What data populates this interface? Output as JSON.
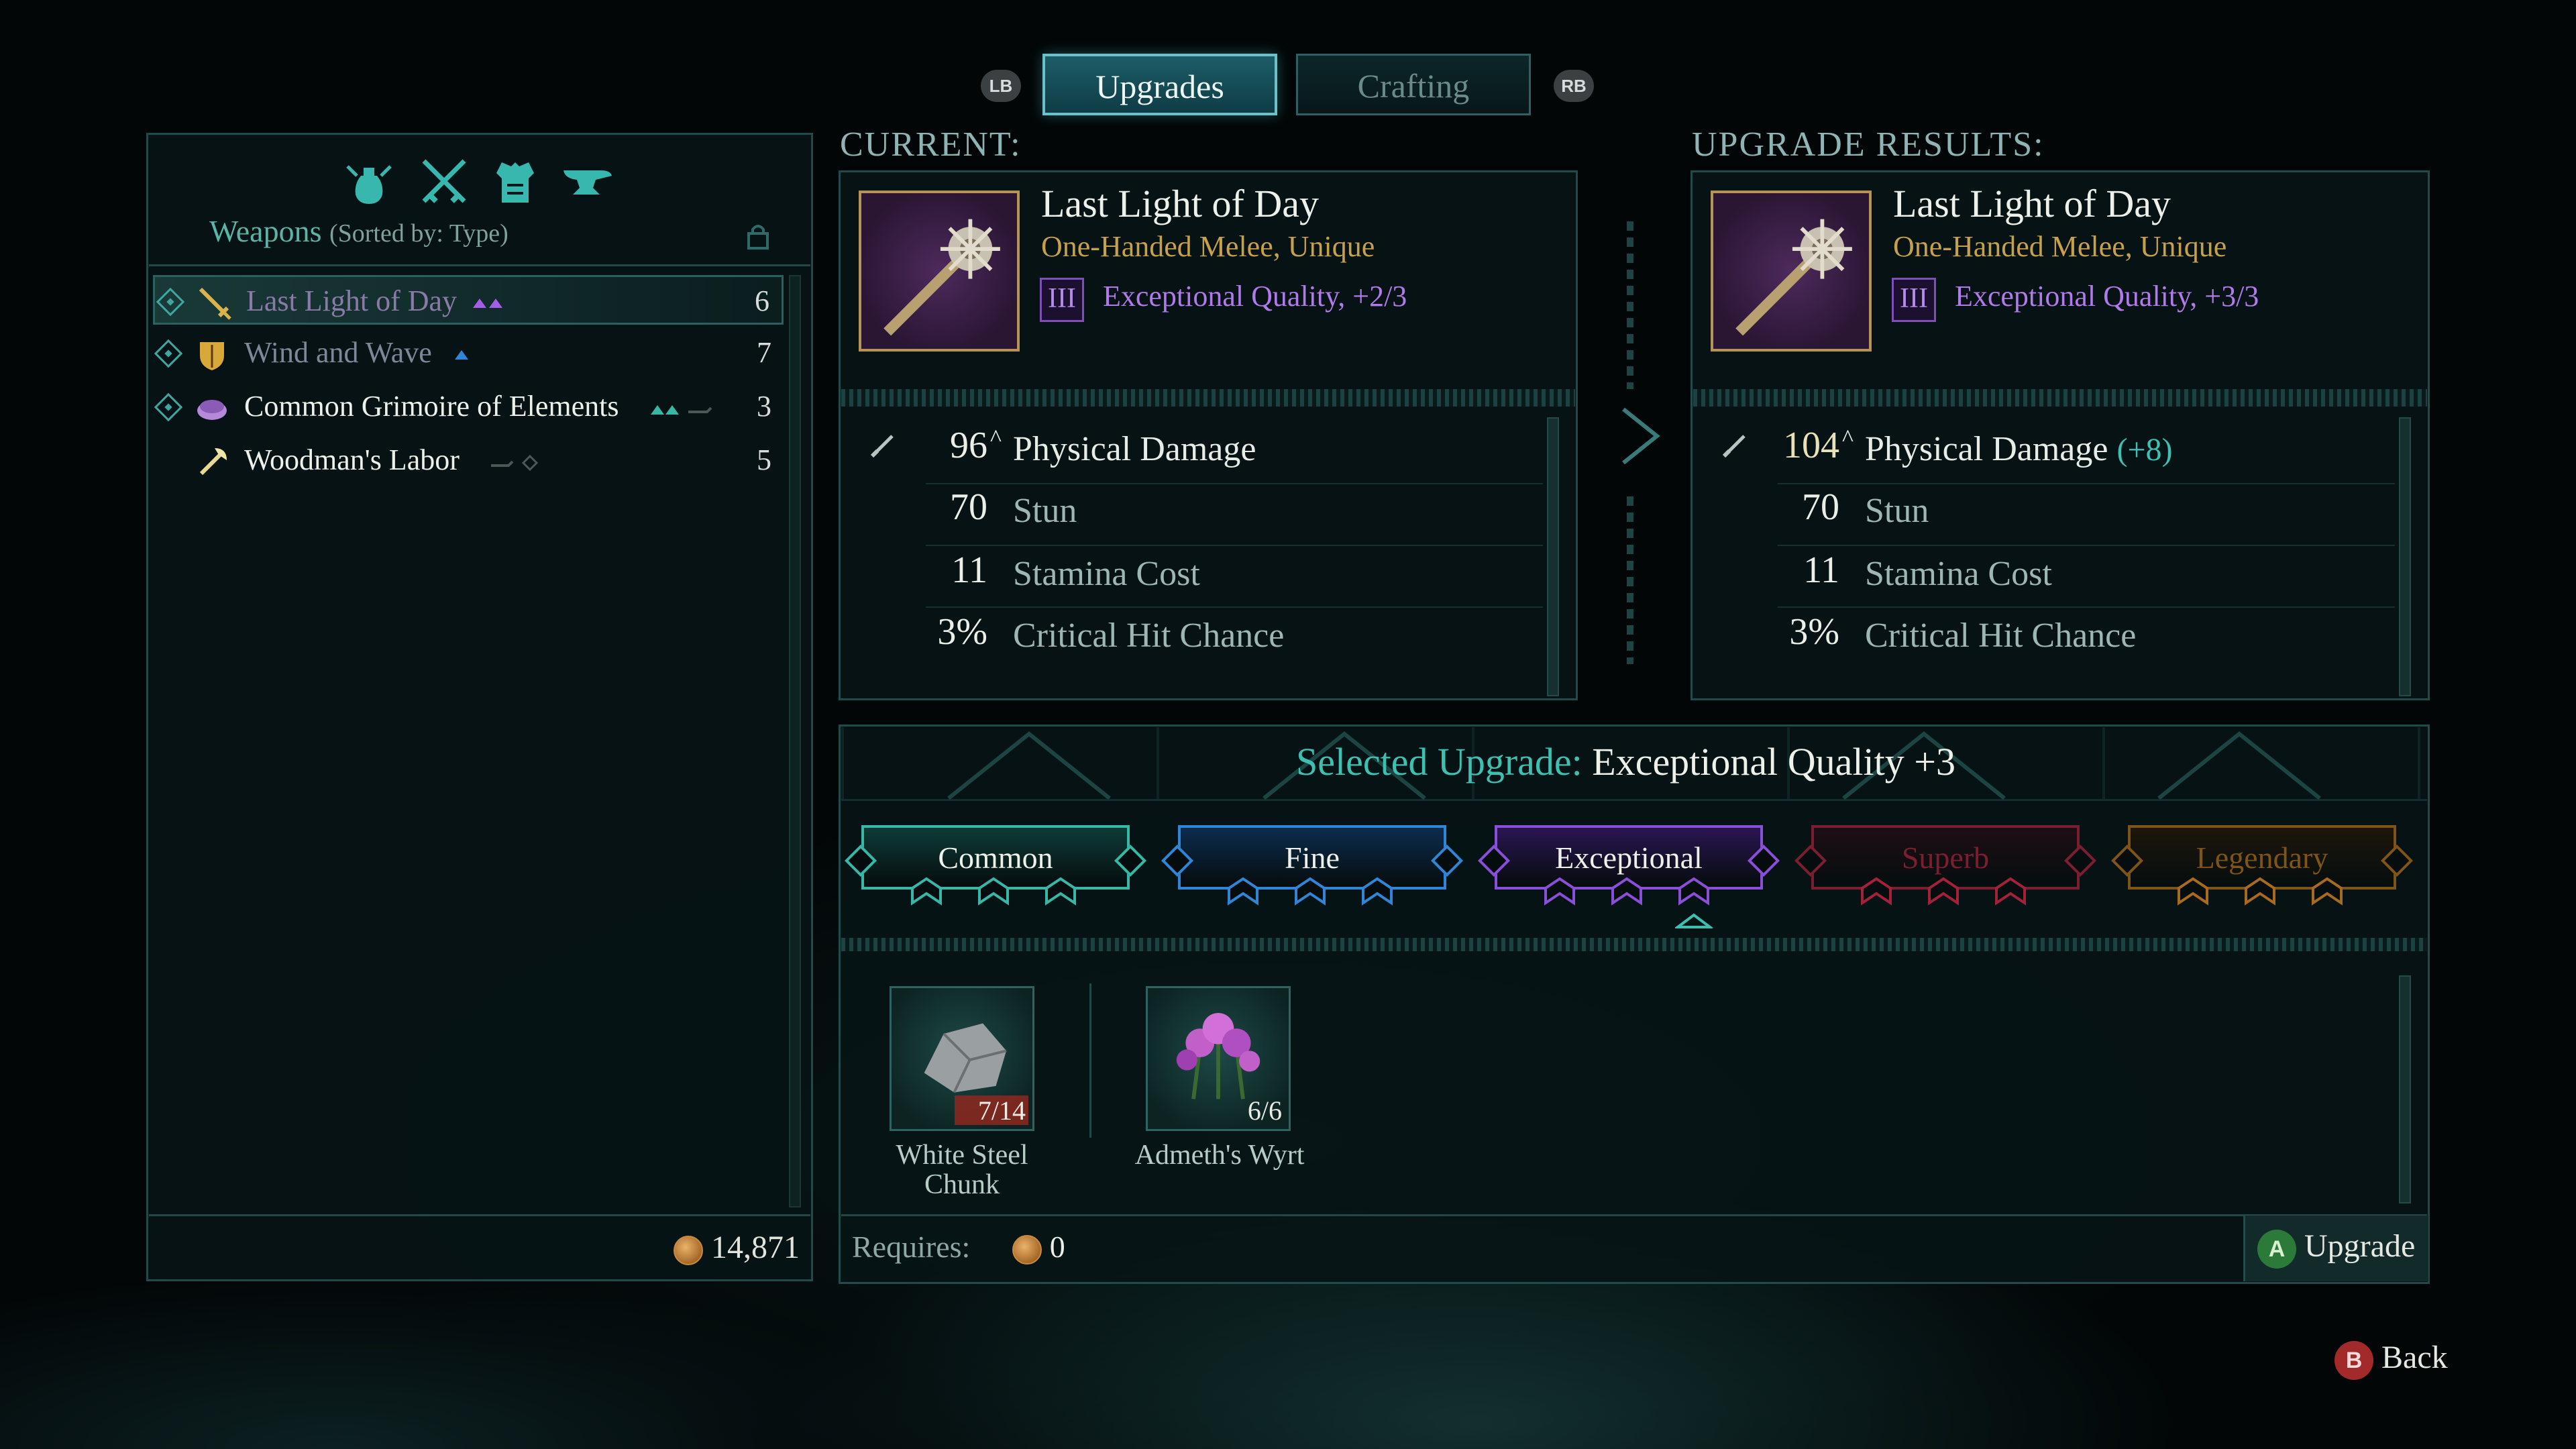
{
  "tabs": {
    "lb": "LB",
    "rb": "RB",
    "upgrades": "Upgrades",
    "crafting": "Crafting"
  },
  "weapons_panel": {
    "title": "Weapons",
    "sort": "(Sorted by: Type)",
    "category_icons": [
      "trinket-bag-icon",
      "crossed-swords-icon",
      "armor-icon",
      "anvil-icon"
    ],
    "items": [
      {
        "name": "Last Light of Day",
        "level": "6",
        "color": "#8a7aa8"
      },
      {
        "name": "Wind and Wave",
        "level": "7",
        "color": "#7d8799"
      },
      {
        "name": "Common Grimoire of Elements",
        "level": "3",
        "color": "#eef0ea"
      },
      {
        "name": "Woodman's Labor",
        "level": "5",
        "color": "#eef0ea"
      }
    ],
    "gold": "14,871"
  },
  "current": {
    "label": "CURRENT:",
    "name": "Last Light of Day",
    "type": "One-Handed Melee, Unique",
    "quality_badge": "III",
    "quality": "Exceptional Quality, +2/3",
    "stats": [
      {
        "value": "96",
        "label": "Physical Damage"
      },
      {
        "value": "70",
        "label": "Stun"
      },
      {
        "value": "11",
        "label": "Stamina Cost"
      },
      {
        "value": "3%",
        "label": "Critical Hit Chance"
      }
    ]
  },
  "result": {
    "label": "UPGRADE RESULTS:",
    "name": "Last Light of Day",
    "type": "One-Handed Melee, Unique",
    "quality_badge": "III",
    "quality": "Exceptional Quality, +3/3",
    "stats": [
      {
        "value": "104",
        "label": "Physical Damage",
        "delta": "(+8)"
      },
      {
        "value": "70",
        "label": "Stun"
      },
      {
        "value": "11",
        "label": "Stamina Cost"
      },
      {
        "value": "3%",
        "label": "Critical Hit Chance"
      }
    ]
  },
  "selected_upgrade": {
    "prefix": "Selected Upgrade:",
    "value": "Exceptional Quality +3",
    "tiers": [
      {
        "label": "Common",
        "color": "#37b7a6"
      },
      {
        "label": "Fine",
        "color": "#2f86d6"
      },
      {
        "label": "Exceptional",
        "color": "#8a4fd8"
      },
      {
        "label": "Superb",
        "color": "#a3223a"
      },
      {
        "label": "Legendary",
        "color": "#a86a1c"
      }
    ]
  },
  "materials": [
    {
      "name_line1": "White Steel",
      "name_line2": "Chunk",
      "count": "7/14"
    },
    {
      "name_line1": "Admeth's Wyrt",
      "name_line2": "",
      "count": "6/6"
    }
  ],
  "requires": {
    "label": "Requires:",
    "amount": "0"
  },
  "buttons": {
    "upgrade_glyph": "A",
    "upgrade": "Upgrade",
    "back_glyph": "B",
    "back": "Back"
  }
}
